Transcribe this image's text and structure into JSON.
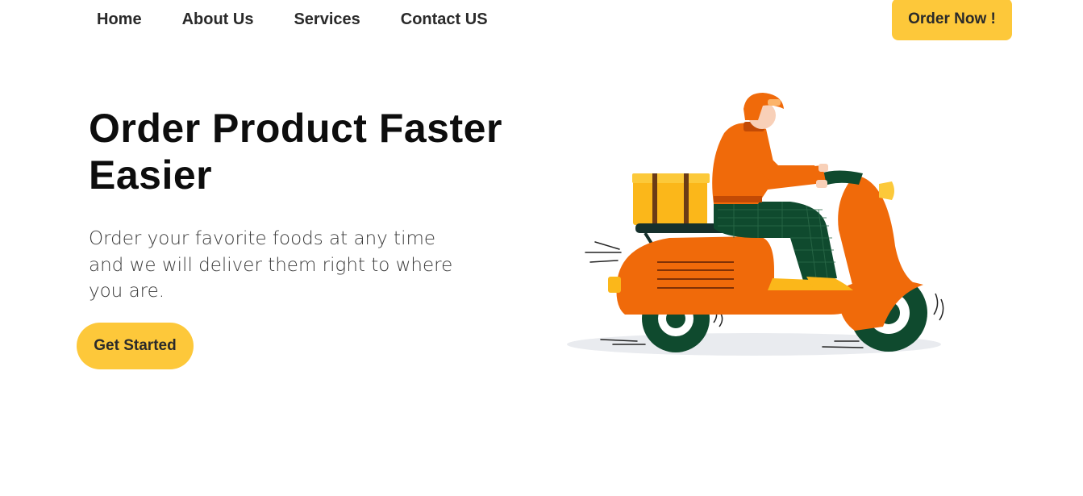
{
  "nav": {
    "links": [
      {
        "label": "Home"
      },
      {
        "label": "About Us"
      },
      {
        "label": "Services"
      },
      {
        "label": "Contact US"
      }
    ],
    "order_button": "Order Now !"
  },
  "hero": {
    "title": "Order Product Faster Easier",
    "subtitle": "Order your favorite foods at any time and we will deliver them right to where you are.",
    "cta": "Get Started"
  },
  "illustration": {
    "icon": "delivery-scooter-illustration"
  },
  "colors": {
    "accent": "#fdc83a",
    "scooter": "#f06a0a",
    "wheel": "#0f4a2e",
    "box": "#fbb71a"
  }
}
